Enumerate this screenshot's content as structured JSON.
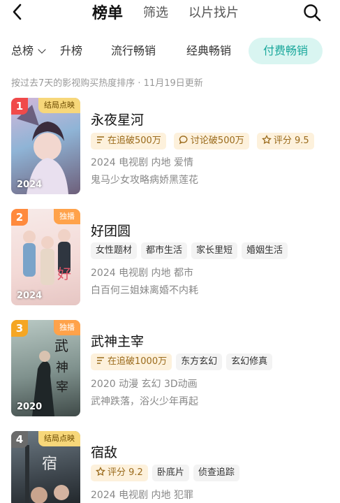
{
  "nav": {
    "tabs": [
      "榜单",
      "筛选",
      "以片找片"
    ]
  },
  "chips": {
    "dropdown_label": "总榜",
    "items": [
      "升榜",
      "流行畅销",
      "经典畅销",
      "付费畅销"
    ]
  },
  "subinfo": "按过去7天的影视购买热度排序 · 11月19日更新",
  "colors": {
    "accent": "#1aa89c",
    "rank1": "#f04a4a",
    "rank2": "#ff8a3d",
    "rank3": "#f5a623",
    "rank4": "#6b6b6b"
  },
  "items": [
    {
      "rank": "1",
      "badge": "结局点映",
      "year": "2024",
      "title": "永夜星河",
      "pills": [
        "在追破500万",
        "讨论破500万",
        "评分 9.5"
      ],
      "meta": "2024 电视剧 内地 爱情",
      "desc": "鬼马少女攻略病娇黑莲花"
    },
    {
      "rank": "2",
      "badge": "独播",
      "year": "2024",
      "title": "好团圆",
      "pills": [
        "女性题材",
        "都市生活",
        "家长里短",
        "婚姻生活"
      ],
      "meta": "2024 电视剧 内地 都市",
      "desc": "白百何三姐妹离婚不内耗"
    },
    {
      "rank": "3",
      "badge": "独播",
      "year": "2020",
      "title": "武神主宰",
      "pills": [
        "在追破1000万",
        "东方玄幻",
        "玄幻修真"
      ],
      "meta": "2020 动漫 玄幻 3D动画",
      "desc": "武神跌落，浴火少年再起"
    },
    {
      "rank": "4",
      "badge": "结局点映",
      "year": "",
      "title": "宿敌",
      "pills": [
        "评分 9.2",
        "卧底片",
        "侦查追踪"
      ],
      "meta": "2024 电视剧 内地 犯罪",
      "desc": ""
    }
  ]
}
